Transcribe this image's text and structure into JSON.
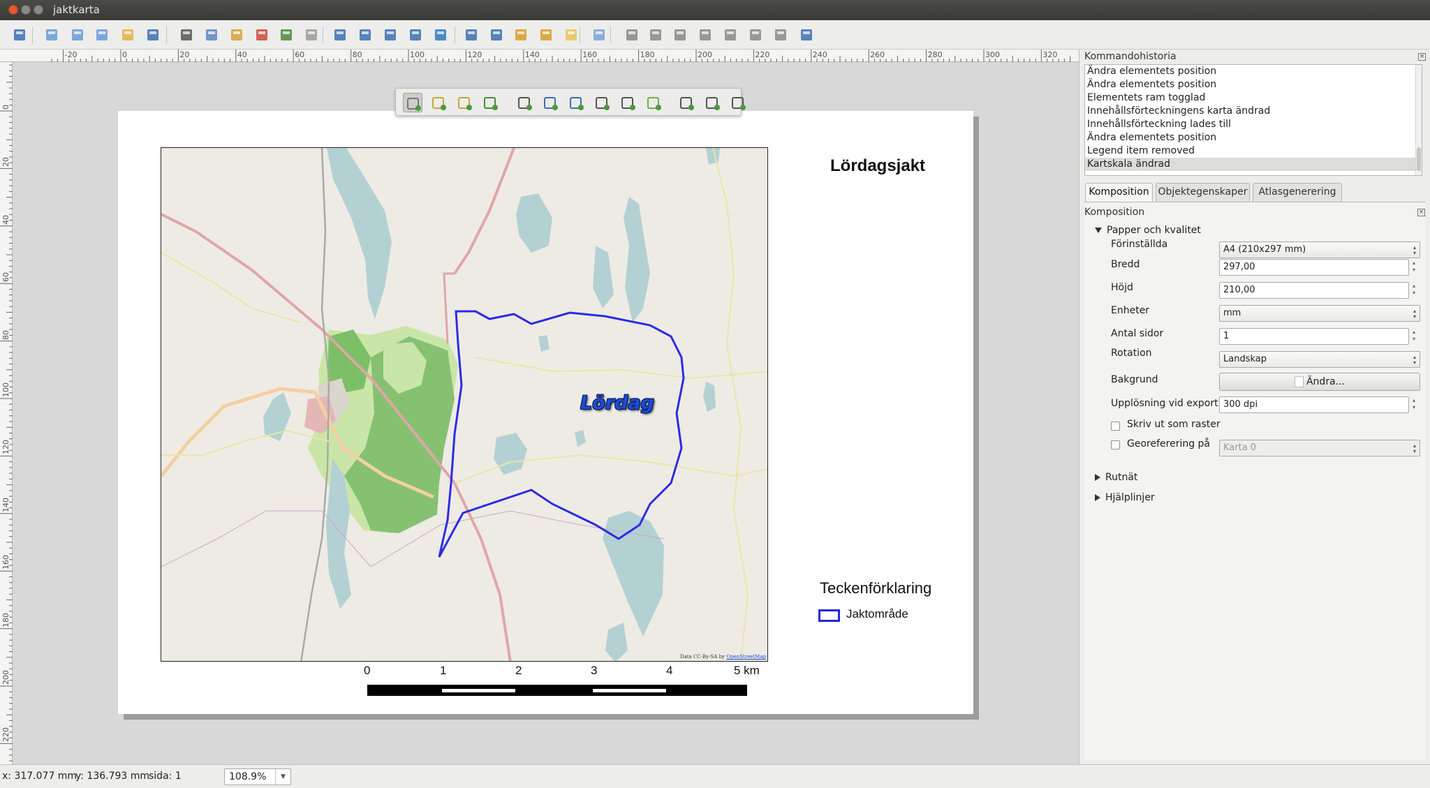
{
  "window": {
    "title": "jaktkarta"
  },
  "toolbar": {
    "buttons": [
      "save-icon",
      "new-composer-icon",
      "duplicate-composer-icon",
      "composer-manager-icon",
      "open-template-icon",
      "save-template-icon",
      "print-icon",
      "export-image-icon",
      "export-svg-icon",
      "export-pdf-icon",
      "undo-icon",
      "redo-icon",
      "zoom-full-icon",
      "zoom-100-icon",
      "zoom-in-icon",
      "zoom-out-icon",
      "refresh-icon",
      "select-all-icon",
      "group-icon",
      "lock-icon",
      "unlock-icon",
      "align-icon",
      "distribute-icon",
      "atlas-preview-icon",
      "atlas-first-icon",
      "atlas-prev-icon",
      "atlas-next-icon",
      "atlas-last-icon",
      "atlas-print-icon",
      "atlas-export-icon",
      "atlas-settings-icon"
    ]
  },
  "ruler": {
    "h_ticks": [
      "-20",
      "0",
      "20",
      "40",
      "60",
      "80",
      "100",
      "120",
      "140",
      "160",
      "180",
      "200",
      "220",
      "240",
      "260",
      "280",
      "300",
      "320"
    ],
    "v_ticks": [
      "0",
      "20",
      "40",
      "60",
      "80",
      "100",
      "120",
      "140",
      "160",
      "180",
      "200",
      "220"
    ]
  },
  "floating_toolbar": {
    "tools": [
      "pan-icon",
      "zoom-tool-icon",
      "select-tool-icon",
      "move-content-icon",
      "add-map-icon",
      "add-image-icon",
      "add-label-icon",
      "add-legend-icon",
      "add-scalebar-icon",
      "add-shape-icon",
      "add-arrow-icon",
      "add-table-icon",
      "add-html-icon"
    ]
  },
  "composition": {
    "title": "Lördagsjakt",
    "map_label": "Lördag",
    "attribution_prefix": "Data CC-By-SA by",
    "attribution_link": "OpenStreetMap",
    "legend": {
      "title": "Teckenförklaring",
      "items": [
        {
          "label": "Jaktområde",
          "color": "#2424e0"
        }
      ]
    },
    "scalebar": {
      "labels": [
        "0",
        "1",
        "2",
        "3",
        "4",
        "5 km"
      ]
    },
    "colors": {
      "hunting_area": "#2b2be6",
      "water": "#b3d1d3",
      "park": "#b5dc94",
      "forest": "#7bb56f",
      "road": "#e3a3a3",
      "base": "#eeebe5"
    }
  },
  "history": {
    "title": "Kommandohistoria",
    "items": [
      "Ändra elementets position",
      "Ändra elementets position",
      "Elementets ram togglad",
      "Innehållsförteckningens karta ändrad",
      "Innehållsförteckning lades till",
      "Ändra elementets position",
      "Legend item removed",
      "Kartskala ändrad"
    ],
    "selected_index": 7
  },
  "tabs": [
    "Komposition",
    "Objektegenskaper",
    "Atlasgenerering"
  ],
  "panel": {
    "title": "Komposition",
    "section_paper": "Papper och kvalitet",
    "presets_label": "Förinställda",
    "presets_value": "A4 (210x297 mm)",
    "width_label": "Bredd",
    "width_value": "297,00",
    "height_label": "Höjd",
    "height_value": "210,00",
    "units_label": "Enheter",
    "units_value": "mm",
    "pages_label": "Antal sidor",
    "pages_value": "1",
    "rotation_label": "Rotation",
    "rotation_value": "Landskap",
    "background_label": "Bakgrund",
    "background_button": "Ändra...",
    "resolution_label": "Upplösning vid export",
    "resolution_value": "300 dpi",
    "raster_label": "Skriv ut som raster",
    "georef_label": "Georeferering på",
    "georef_value": "Karta 0",
    "section_grid": "Rutnät",
    "section_guides": "Hjälplinjer"
  },
  "status": {
    "x": "x: 317.077 mm",
    "y": "y: 136.793 mm",
    "page": "sida: 1",
    "zoom": "108.9%"
  }
}
